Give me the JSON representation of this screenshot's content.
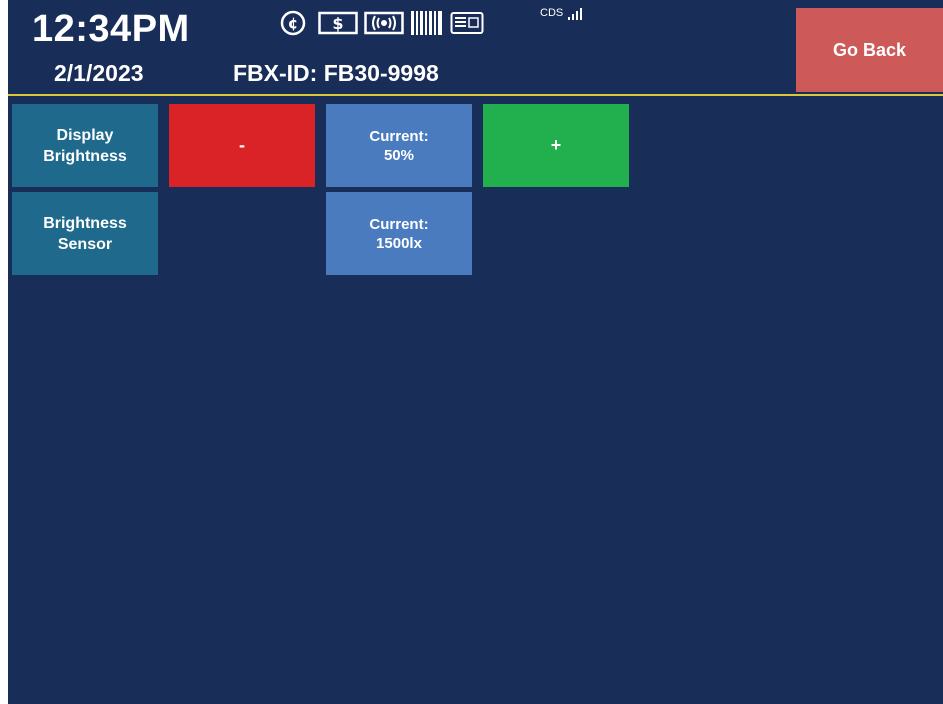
{
  "header": {
    "time": "12:34PM",
    "date": "2/1/2023",
    "fbx_id": "FBX-ID: FB30-9998",
    "status_text": "CDS",
    "icons": [
      "cent-coin-icon",
      "dollar-bill-icon",
      "contactless-icon",
      "barcode-icon",
      "card-reader-icon",
      "signal-strength-icon"
    ]
  },
  "go_back_label": "Go Back",
  "rows": [
    {
      "label_line1": "Display",
      "label_line2": "Brightness",
      "minus_label": "-",
      "current_line1": "Current:",
      "current_line2": "50%",
      "plus_label": "+"
    },
    {
      "label_line1": "Brightness",
      "label_line2": "Sensor",
      "current_line1": "Current:",
      "current_line2": "1500lx"
    }
  ],
  "colors": {
    "background": "#182d58",
    "divider": "#d8c83a",
    "go_back": "#cd5a58",
    "label_tile": "#1f6a8c",
    "value_tile": "#4a7bbf",
    "minus": "#d92327",
    "plus": "#22b04e"
  }
}
